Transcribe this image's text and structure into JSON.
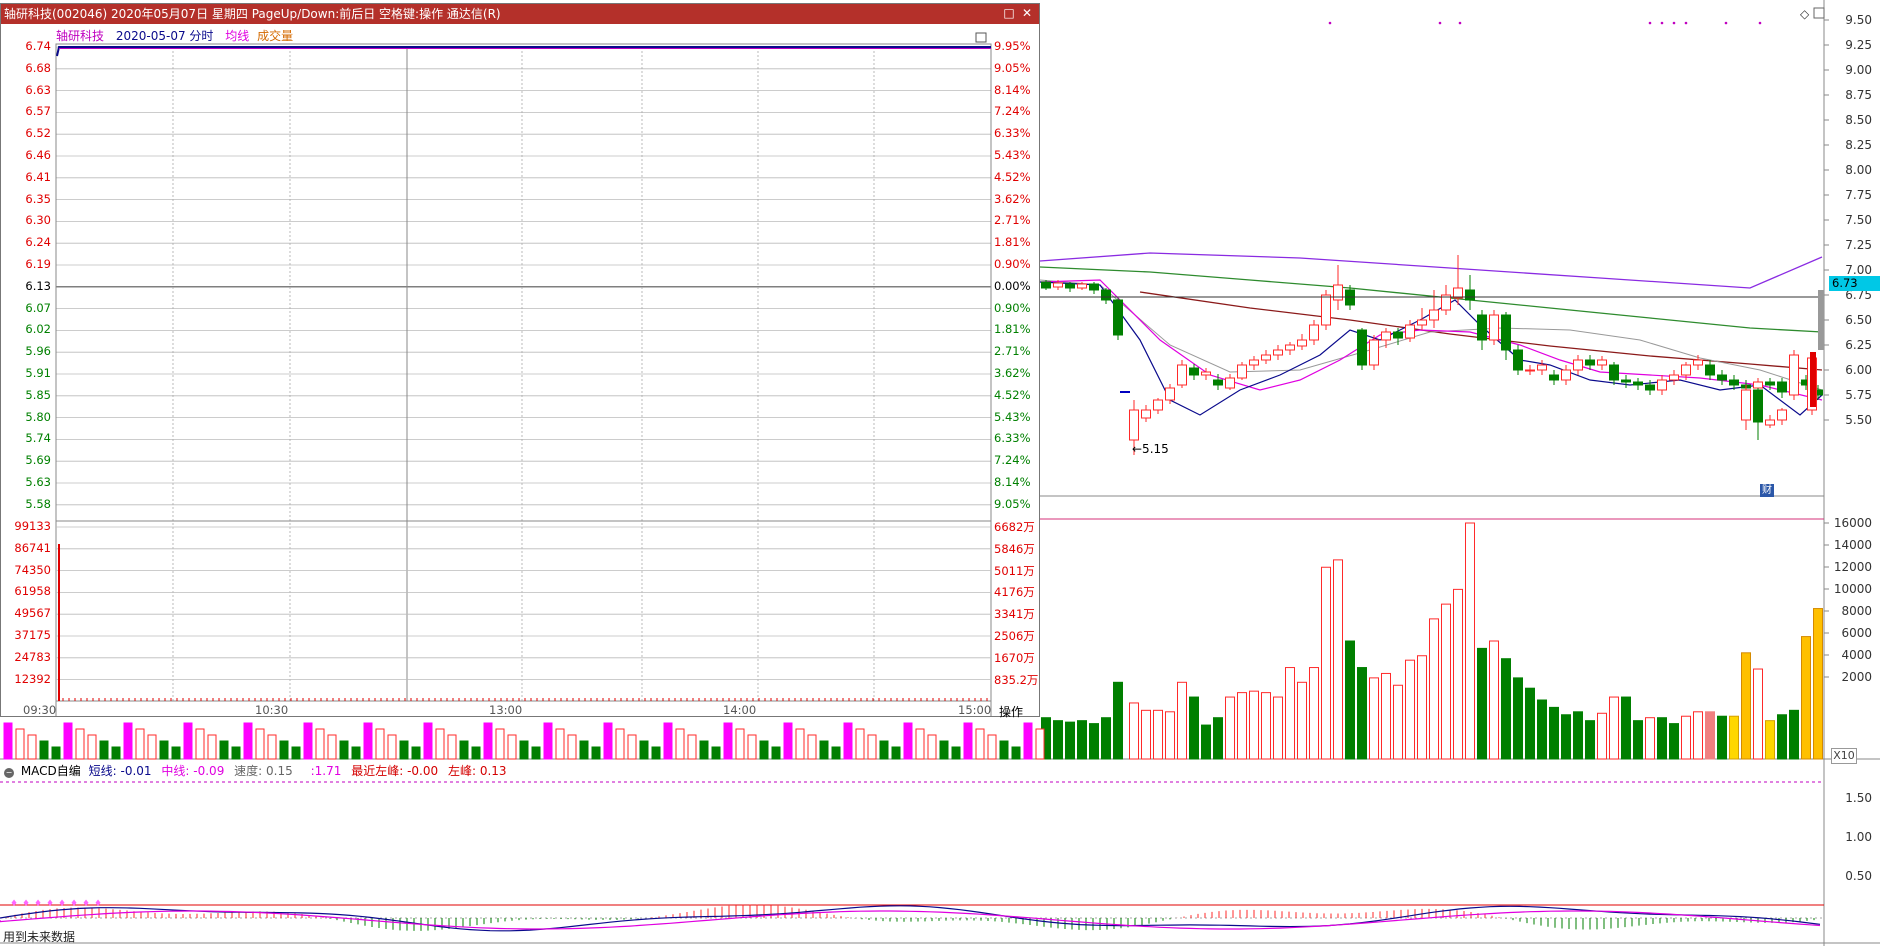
{
  "popup": {
    "title": "轴研科技(002046) 2020年05月07日 星期四 PageUp/Down:前后日 空格键:操作 通达信(R)",
    "restore_icon": "□",
    "close_icon": "✕",
    "legend": {
      "name": "轴研科技",
      "date_label": "2020-05-07 分时",
      "avg_line": "均线",
      "volume": "成交量"
    },
    "price_axis_left": [
      "6.74",
      "6.68",
      "6.63",
      "6.57",
      "6.52",
      "6.46",
      "6.41",
      "6.35",
      "6.30",
      "6.24",
      "6.19",
      "6.13",
      "6.07",
      "6.02",
      "5.96",
      "5.91",
      "5.85",
      "5.80",
      "5.74",
      "5.69",
      "5.63",
      "5.58"
    ],
    "pct_axis_right": [
      "9.95%",
      "9.05%",
      "8.14%",
      "7.24%",
      "6.33%",
      "5.43%",
      "4.52%",
      "3.62%",
      "2.71%",
      "1.81%",
      "0.90%",
      "0.00%",
      "0.90%",
      "1.81%",
      "2.71%",
      "3.62%",
      "4.52%",
      "5.43%",
      "6.33%",
      "7.24%",
      "8.14%",
      "9.05%"
    ],
    "volume_axis_left": [
      "99133",
      "86741",
      "74350",
      "61958",
      "49567",
      "37175",
      "24783",
      "12392"
    ],
    "amount_axis_right": [
      "6682万",
      "5846万",
      "5011万",
      "4176万",
      "3341万",
      "2506万",
      "1670万",
      "835.2万"
    ],
    "time_labels": [
      "09:30",
      "10:30",
      "13:00",
      "14:00",
      "15:00"
    ],
    "operate_button": "操作"
  },
  "main_chart": {
    "price_axis": [
      "9.50",
      "9.25",
      "9.00",
      "8.75",
      "8.50",
      "8.25",
      "8.00",
      "7.75",
      "7.50",
      "7.25",
      "7.00",
      "6.75",
      "6.50",
      "6.25",
      "6.00",
      "5.75",
      "5.50"
    ],
    "volume_axis": [
      "16000",
      "14000",
      "12000",
      "10000",
      "8000",
      "6000",
      "4000",
      "2000"
    ],
    "current_price": "6.73",
    "low_marker": "←5.15",
    "finance_icon": "财",
    "volume_scale_button": "X10",
    "diamond_icon": "◇",
    "colors": {
      "up": "#ff2a2a",
      "down": "#007f00",
      "ma5": "#0a0a8c",
      "ma10": "#e000e0",
      "ma20": "#999999",
      "ma60": "#8b1a1a",
      "ma120": "#2e8b2e",
      "ma250": "#8a2be2"
    }
  },
  "macd": {
    "title": "MACD自编",
    "short_label": "短线:",
    "short_value": "-0.01",
    "mid_label": "中线:",
    "mid_value": "-0.09",
    "speed_label": "速度:",
    "speed_value": "0.15",
    "ratio_value": ":1.71",
    "recent_left_peak_label": "最近左峰:",
    "recent_left_peak_value": "-0.00",
    "left_peak_label": "左峰:",
    "left_peak_value": "0.13",
    "axis": [
      "1.50",
      "1.00",
      "0.50"
    ]
  },
  "footer_note": "用到未来数据"
}
